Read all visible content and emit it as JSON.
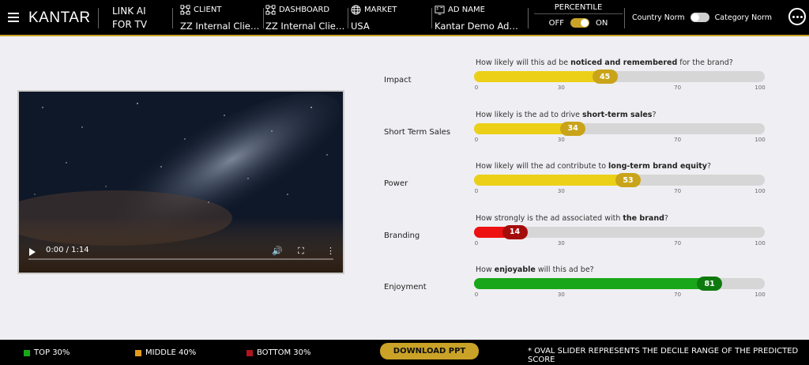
{
  "header": {
    "brand": "KANTAR",
    "product_line1": "LINK AI",
    "product_line2": "FOR TV",
    "filters": [
      {
        "label": "CLIENT",
        "value": "ZZ Internal Client D...",
        "icon": "network-icon"
      },
      {
        "label": "DASHBOARD",
        "value": "ZZ Internal Client D...",
        "icon": "network-icon"
      },
      {
        "label": "MARKET",
        "value": "USA",
        "icon": "globe-icon"
      },
      {
        "label": "AD NAME",
        "value": "Kantar Demo Ad St...",
        "icon": "video-icon"
      }
    ],
    "percentile": {
      "title": "PERCENTILE",
      "off": "OFF",
      "on": "ON",
      "state": true
    },
    "norm": {
      "country": "Country Norm",
      "category": "Category Norm",
      "state": false
    }
  },
  "video": {
    "time": "0:00 / 1:14",
    "progress": 0
  },
  "metrics": [
    {
      "label": "Impact",
      "q_pre": "How likely will this ad be ",
      "q_bold": "noticed and remembered",
      "q_post": " for the brand?",
      "value": 45,
      "tier": "middle"
    },
    {
      "label": "Short Term Sales",
      "q_pre": "How likely is the ad to drive ",
      "q_bold": "short-term sales",
      "q_post": "?",
      "value": 34,
      "tier": "middle"
    },
    {
      "label": "Power",
      "q_pre": "How likely will the ad contribute to ",
      "q_bold": "long-term brand equity",
      "q_post": "?",
      "value": 53,
      "tier": "middle"
    },
    {
      "label": "Branding",
      "q_pre": "How strongly is the ad associated with ",
      "q_bold": "the brand",
      "q_post": "?",
      "value": 14,
      "tier": "bottom"
    },
    {
      "label": "Enjoyment",
      "q_pre": "How ",
      "q_bold": "enjoyable",
      "q_post": " will this ad be?",
      "value": 81,
      "tier": "top"
    }
  ],
  "scale": {
    "ticks": [
      "0",
      "30",
      "70",
      "100"
    ],
    "tick_values": [
      0,
      30,
      70,
      100
    ],
    "max": 100
  },
  "colors": {
    "top": "#1aa61a",
    "top_oval": "#0e7a0e",
    "middle": "#ecd017",
    "middle_oval": "#c9a41a",
    "bottom": "#ee1111",
    "bottom_oval": "#a50d0d",
    "accent": "#c9a227"
  },
  "footer": {
    "legend": [
      {
        "label": "TOP 30%",
        "color": "#1aa61a"
      },
      {
        "label": "MIDDLE 40%",
        "color": "#e39d1c"
      },
      {
        "label": "BOTTOM 30%",
        "color": "#b0141e"
      }
    ],
    "download": "DOWNLOAD PPT",
    "note": "* OVAL SLIDER REPRESENTS THE DECILE RANGE OF THE PREDICTED SCORE"
  }
}
